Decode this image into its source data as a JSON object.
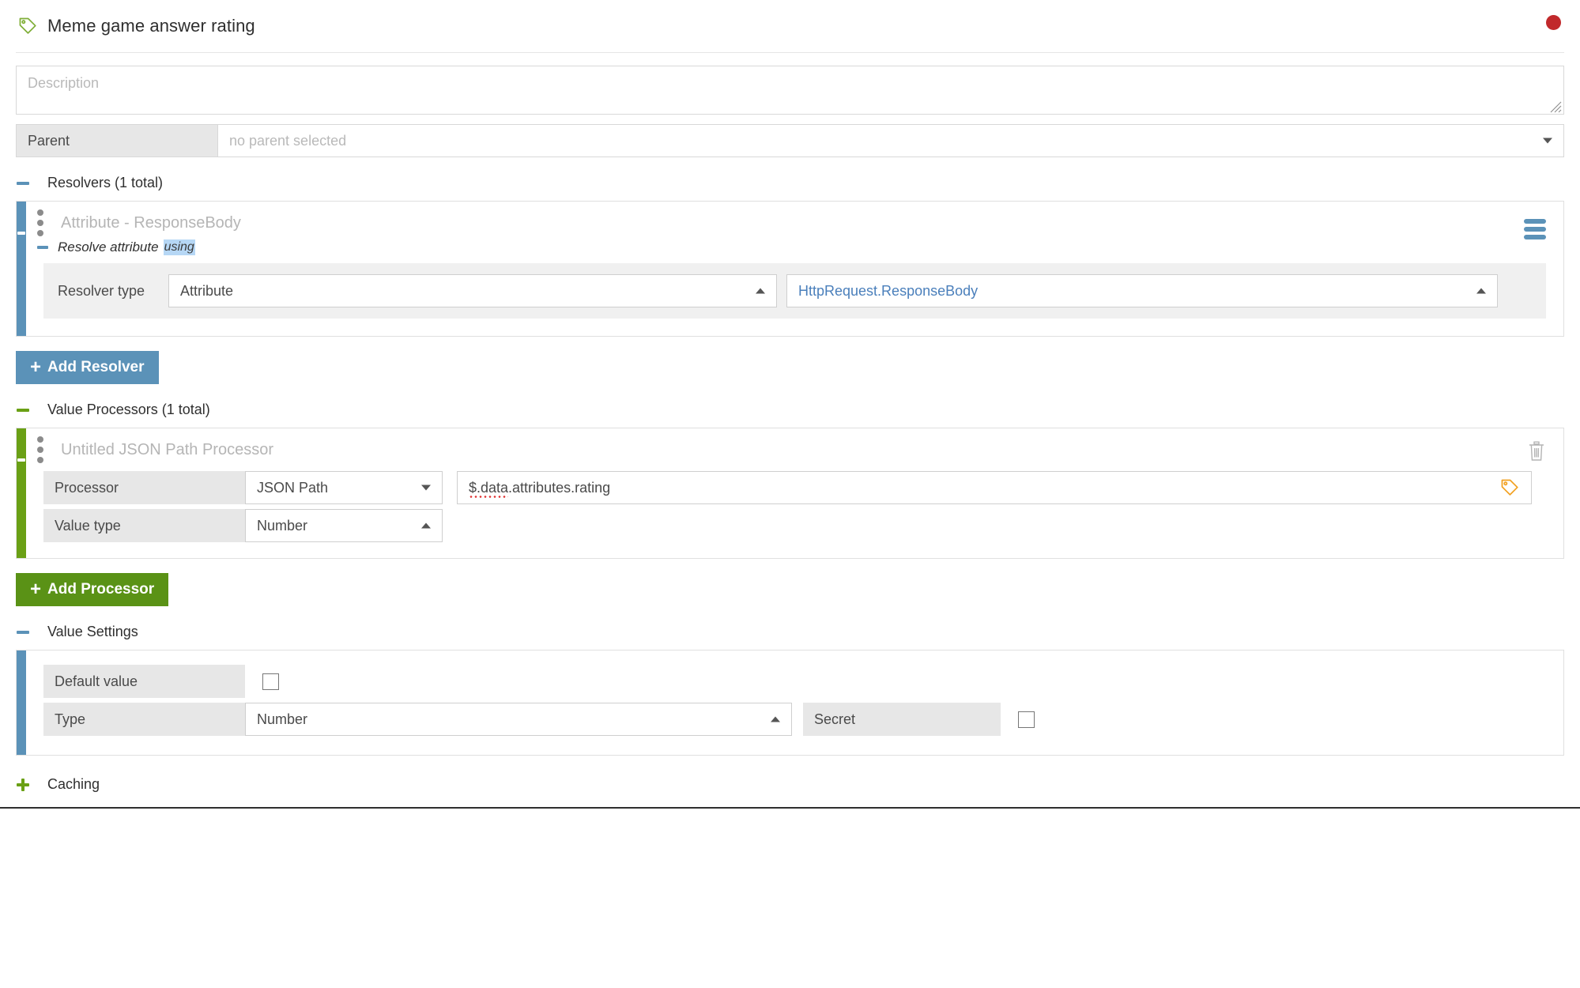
{
  "header": {
    "title": "Meme game answer rating",
    "tag_icon": "tag-icon",
    "status_color": "#c1292b"
  },
  "description": {
    "placeholder": "Description",
    "value": ""
  },
  "parent": {
    "label": "Parent",
    "placeholder": "no parent selected",
    "value": ""
  },
  "resolvers": {
    "section_label": "Resolvers (1 total)",
    "card": {
      "title": "Attribute - ResponseBody",
      "subhead_prefix": "Resolve attribute",
      "subhead_highlight": "using",
      "type_label": "Resolver type",
      "type_value": "Attribute",
      "source_value": "HttpRequest.ResponseBody"
    },
    "add_button": "Add Resolver",
    "add_button_color": "#5b92b8"
  },
  "processors": {
    "section_label": "Value Processors (1 total)",
    "card": {
      "title": "Untitled JSON Path Processor",
      "rows": [
        {
          "label": "Processor",
          "value": "JSON Path"
        },
        {
          "label": "Value type",
          "value": "Number"
        }
      ],
      "path_value": "$.data.attributes.rating",
      "path_spell_error": "$.data"
    },
    "add_button": "Add Processor",
    "add_button_color": "#5a9216"
  },
  "value_settings": {
    "section_label": "Value Settings",
    "default_value_label": "Default value",
    "default_value_checked": false,
    "type_label": "Type",
    "type_value": "Number",
    "secret_label": "Secret",
    "secret_checked": false
  },
  "caching": {
    "section_label": "Caching",
    "expanded": false
  }
}
